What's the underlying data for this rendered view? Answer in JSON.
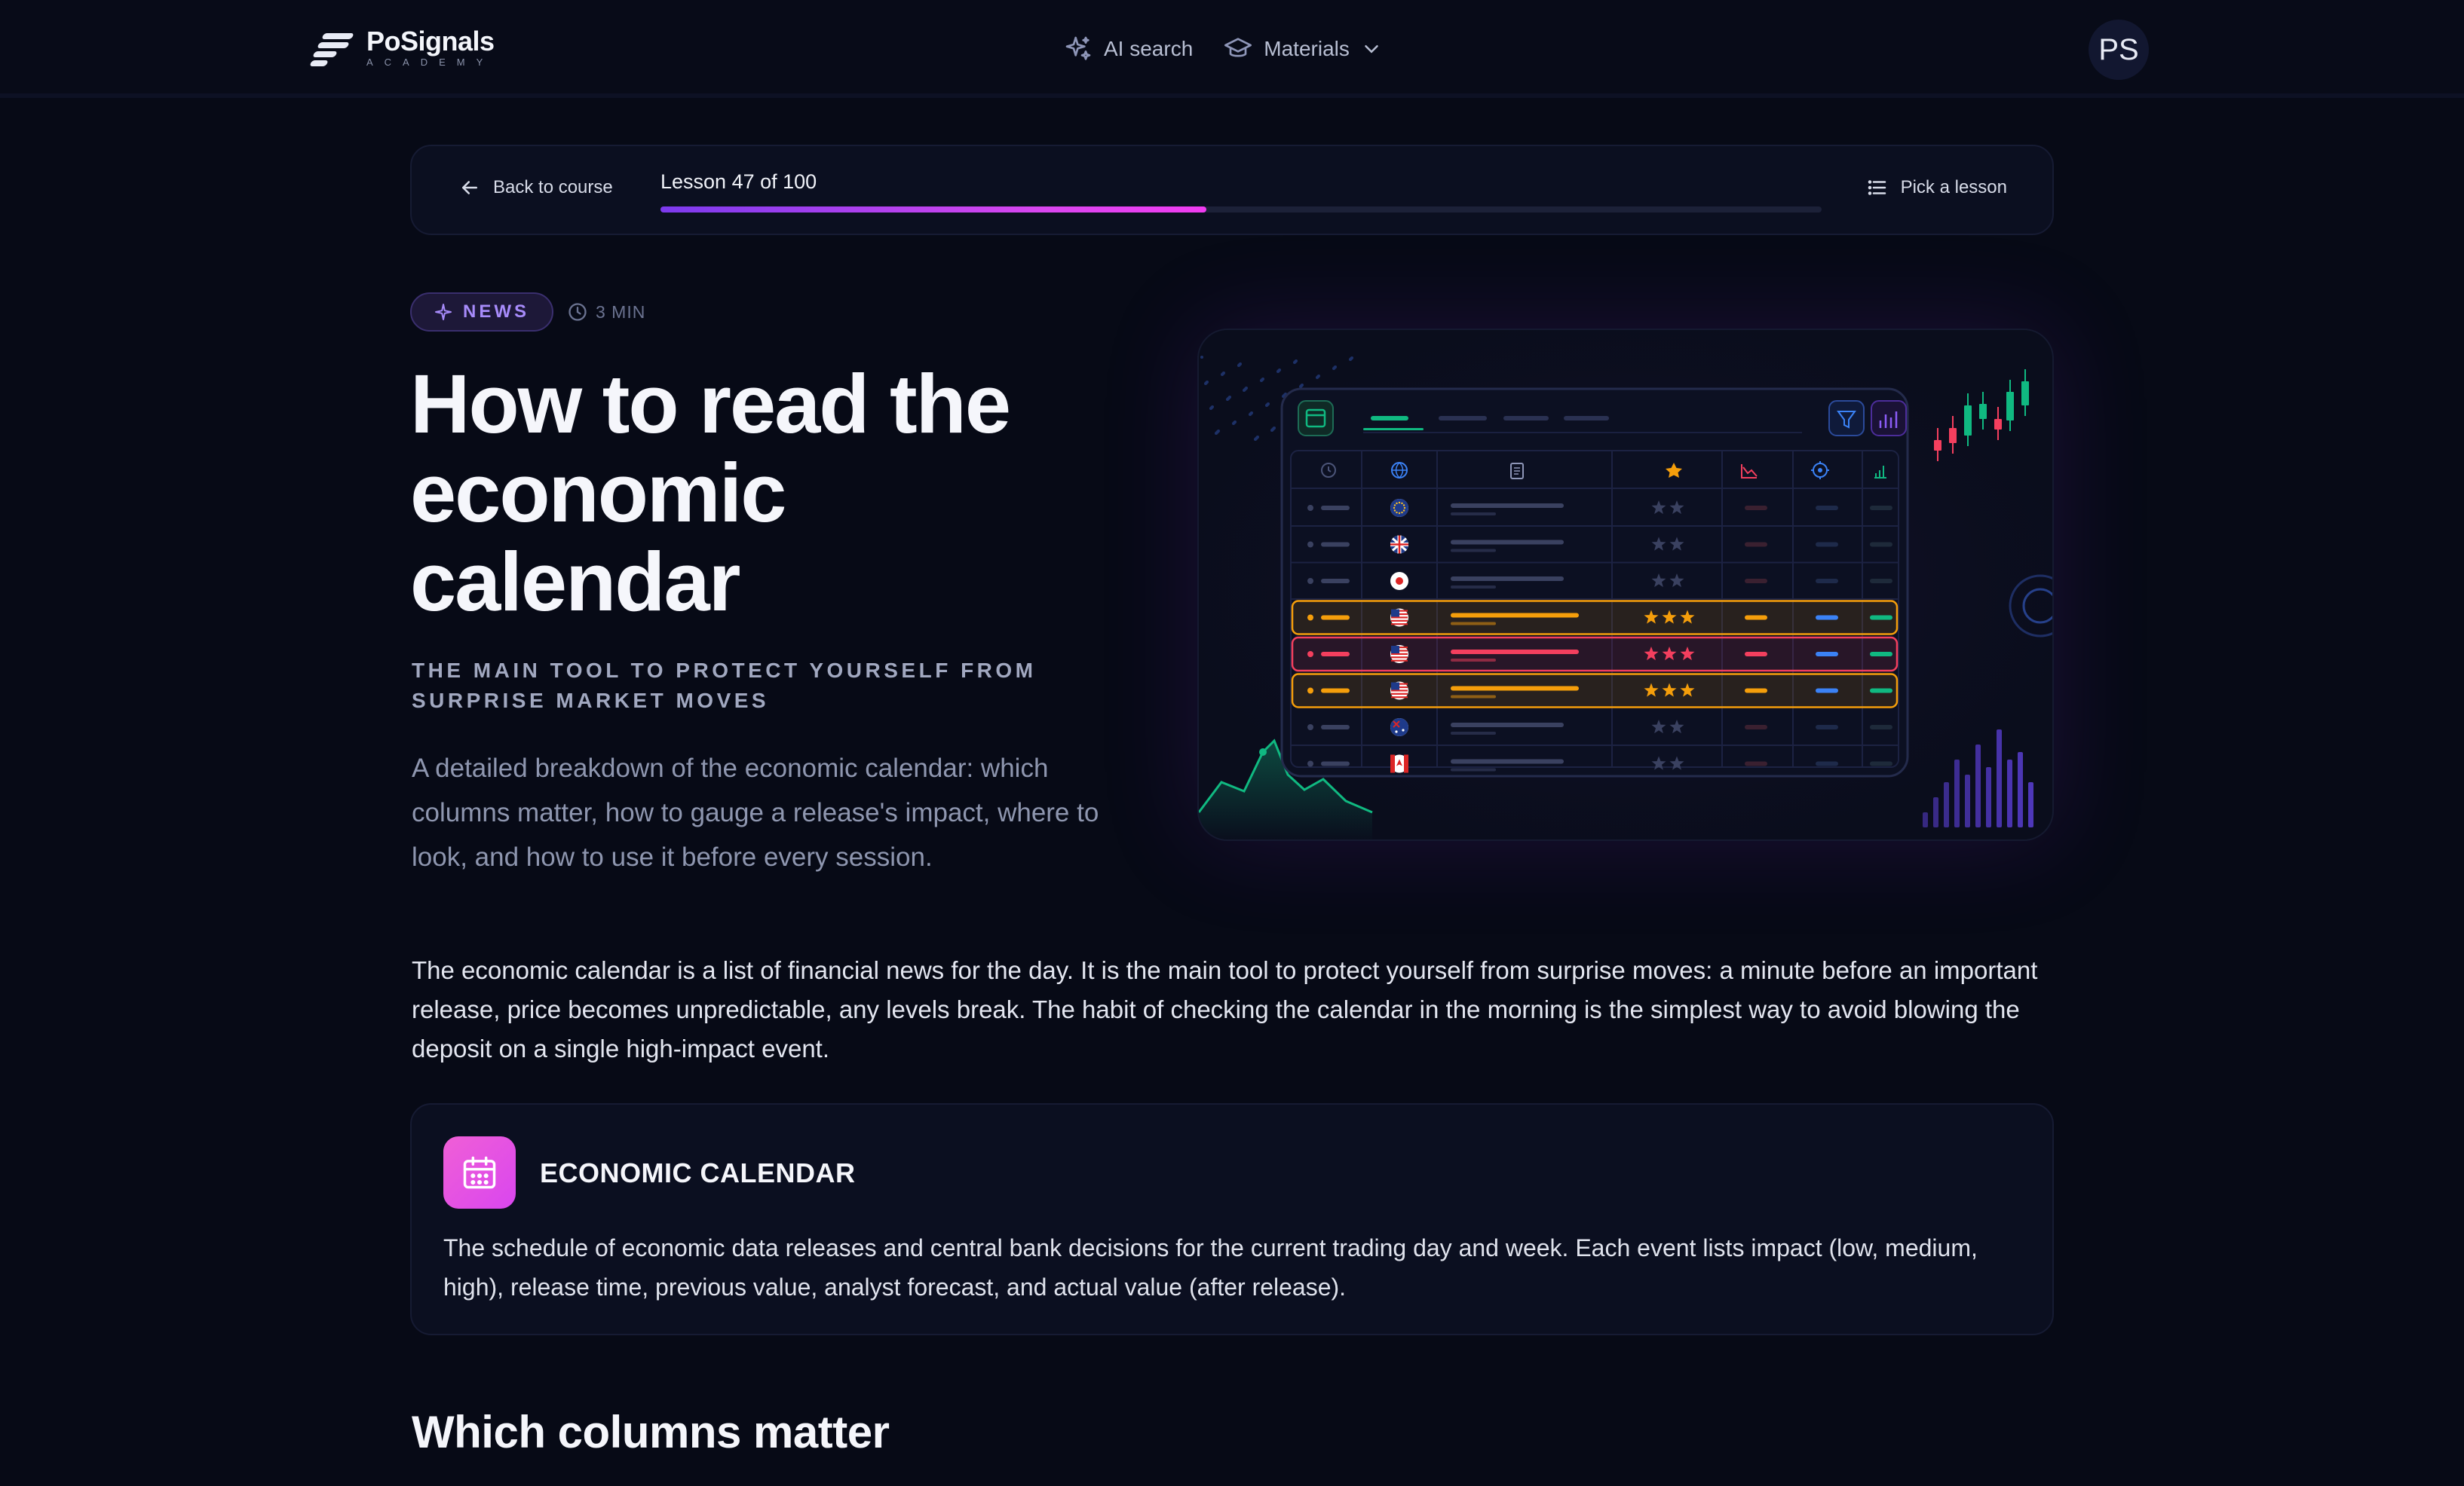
{
  "header": {
    "logo_name": "PoSignals",
    "logo_sub": "ACADEMY",
    "nav": {
      "ai_search": "AI search",
      "materials": "Materials"
    },
    "avatar_initials": "PS"
  },
  "lesson_bar": {
    "back_label": "Back to course",
    "lesson_counter": "Lesson 47 of 100",
    "progress": 0.47,
    "pick_label": "Pick a lesson"
  },
  "hero": {
    "tag": "NEWS",
    "read_time": "3 MIN",
    "title": "How to read the economic calendar",
    "subtitle": "THE MAIN TOOL TO PROTECT YOURSELF FROM SURPRISE MARKET MOVES",
    "lede": "A detailed breakdown of the economic calendar: which columns matter, how to gauge a release's impact, where to look, and how to use it before every session."
  },
  "illustration": {
    "rows": [
      {
        "flag": "eu",
        "stars": 2,
        "highlight": "none"
      },
      {
        "flag": "uk",
        "stars": 2,
        "highlight": "none"
      },
      {
        "flag": "jp",
        "stars": 2,
        "highlight": "none"
      },
      {
        "flag": "us",
        "stars": 3,
        "highlight": "orange"
      },
      {
        "flag": "us",
        "stars": 3,
        "highlight": "red"
      },
      {
        "flag": "us",
        "stars": 3,
        "highlight": "orange"
      },
      {
        "flag": "au",
        "stars": 2,
        "highlight": "none"
      },
      {
        "flag": "ca",
        "stars": 2,
        "highlight": "none"
      }
    ],
    "colors": {
      "orange": "#f59e0b",
      "red": "#f43f5e",
      "green": "#10b981",
      "blue": "#3b82f6"
    }
  },
  "body": {
    "intro": "The economic calendar is a list of financial news for the day. It is the main tool to protect yourself from surprise moves: a minute before an important release, price becomes unpredictable, any levels break. The habit of checking the calendar in the morning is the simplest way to avoid blowing the deposit on a single high-impact event.",
    "card_title": "ECONOMIC CALENDAR",
    "card_text": "The schedule of economic data releases and central bank decisions for the current trading day and week. Each event lists impact (low, medium, high), release time, previous value, analyst forecast, and actual value (after release).",
    "section_heading": "Which columns matter"
  }
}
